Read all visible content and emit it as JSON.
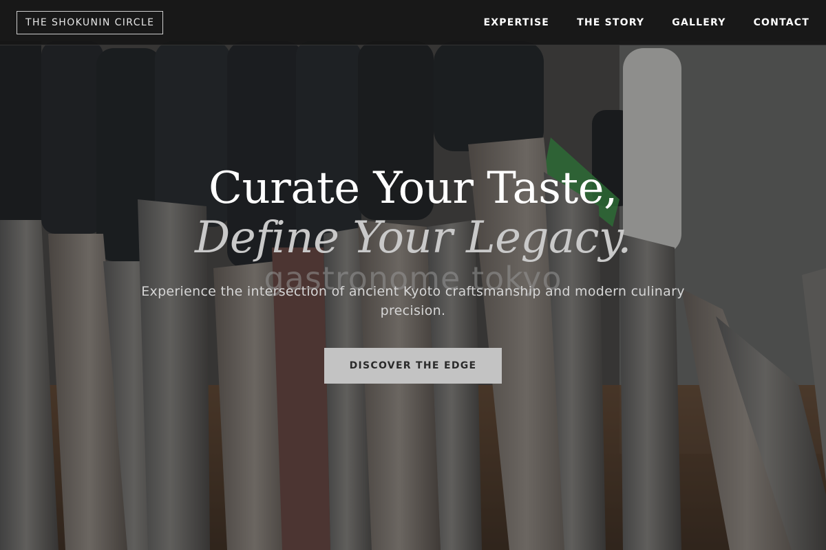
{
  "header": {
    "logo_text": "THE SHOKUNIN CIRCLE",
    "nav": [
      {
        "label": "EXPERTISE"
      },
      {
        "label": "THE STORY"
      },
      {
        "label": "GALLERY"
      },
      {
        "label": "CONTACT"
      }
    ]
  },
  "hero": {
    "title_line1": "Curate Your Taste,",
    "title_line2": "Define Your Legacy.",
    "watermark": "gastronome tokyo",
    "subtitle": "Experience the intersection of ancient Kyoto craftsmanship and modern culinary precision.",
    "cta_label": "DISCOVER THE EDGE",
    "background_image": "knife-rack-photo"
  },
  "colors": {
    "header_bg": "#161616",
    "text_primary": "#ffffff",
    "text_muted": "#c9c9c9",
    "cta_bg": "#c3c3c3",
    "cta_text": "#2a2a2a"
  }
}
